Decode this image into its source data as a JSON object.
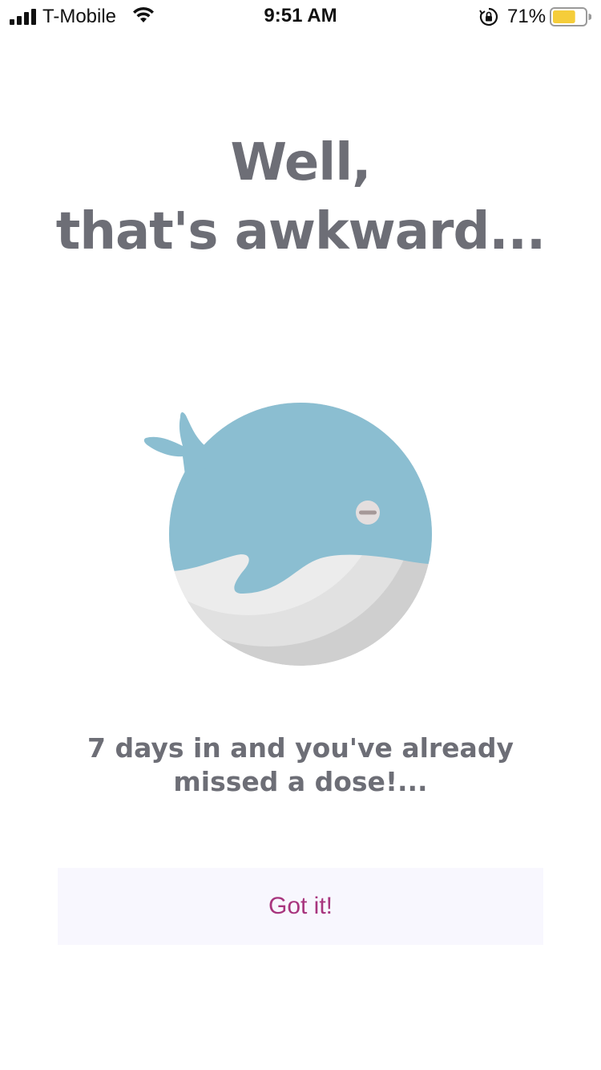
{
  "status_bar": {
    "carrier": "T-Mobile",
    "time": "9:51 AM",
    "battery_percent": "71%",
    "battery_level": 0.71,
    "battery_color": "#f5cd3a",
    "signal_bars": 4,
    "icons": [
      "signal-icon",
      "wifi-icon",
      "orientation-lock-icon",
      "battery-icon"
    ]
  },
  "headline": {
    "line1": "Well,",
    "line2": "that's awkward..."
  },
  "illustration": {
    "name": "whale-illustration",
    "body_color": "#8bbed1",
    "belly_color": "#ebebeb",
    "shadow_color": "#cfcfcf"
  },
  "message": {
    "line1": "7 days in and you've already",
    "line2": "missed a dose!..."
  },
  "button": {
    "label": "Got it!",
    "text_color": "#a8357e",
    "background": "#f8f7fe"
  }
}
